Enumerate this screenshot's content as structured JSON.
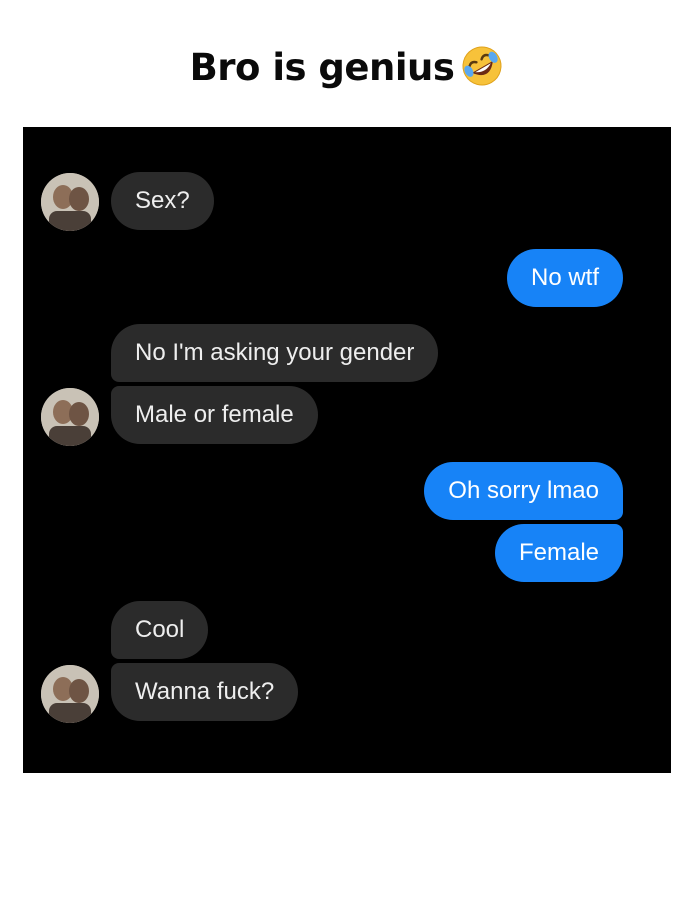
{
  "caption": {
    "text": "Bro is genius",
    "emoji_icon": "rolling-on-floor-laughing-emoji-icon"
  },
  "chat": {
    "messages": [
      {
        "side": "incoming",
        "text": "Sex?"
      },
      {
        "side": "outgoing",
        "text": "No wtf"
      },
      {
        "side": "incoming",
        "text": "No I'm asking your gender"
      },
      {
        "side": "incoming",
        "text": "Male or female"
      },
      {
        "side": "outgoing",
        "text": "Oh sorry lmao"
      },
      {
        "side": "outgoing",
        "text": "Female"
      },
      {
        "side": "incoming",
        "text": "Cool"
      },
      {
        "side": "incoming",
        "text": "Wanna fuck?"
      }
    ]
  },
  "colors": {
    "page_background": "#ffffff",
    "chat_background": "#000000",
    "incoming_bubble": "#2b2b2b",
    "outgoing_bubble": "#1783f7"
  }
}
